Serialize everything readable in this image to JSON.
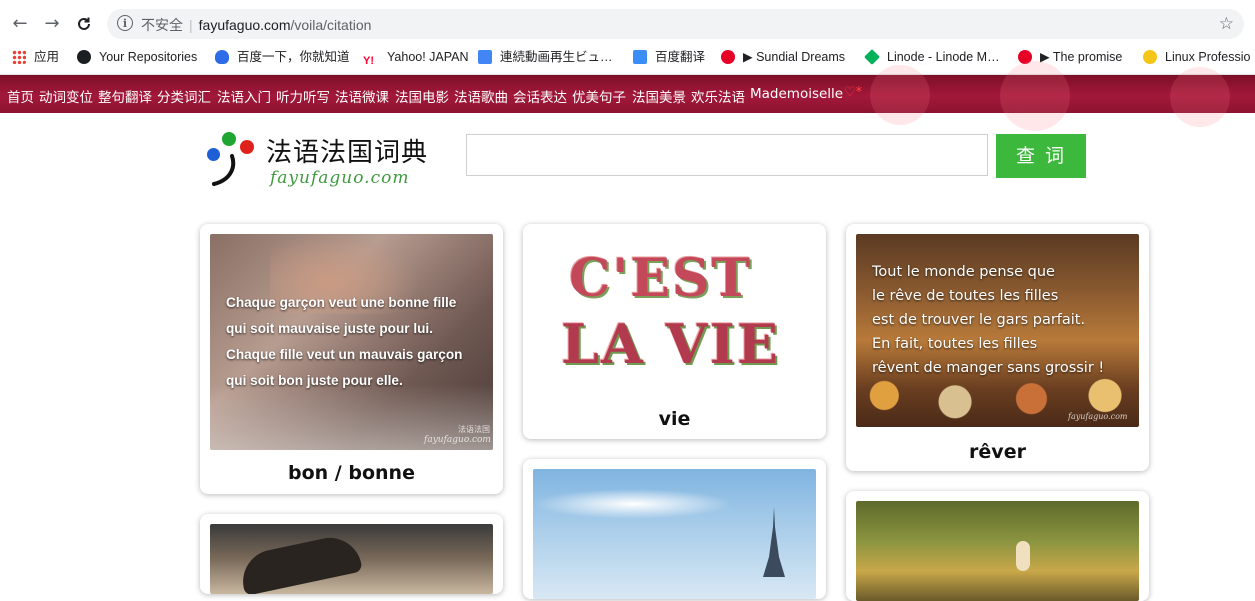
{
  "browser": {
    "back_icon": "arrow-left-icon",
    "forward_icon": "arrow-right-icon",
    "reload_icon": "reload-icon",
    "security_label": "不安全",
    "url_host": "fayufaguo.com",
    "url_path": "/voila/citation",
    "bookmark_star_icon": "star-icon"
  },
  "bookmarks": [
    {
      "label": "应用",
      "icon": "apps-grid-icon"
    },
    {
      "label": "Your Repositories",
      "icon": "github-icon"
    },
    {
      "label": "百度一下，你就知道",
      "icon": "baidu-paw-icon"
    },
    {
      "label": "Yahoo! JAPAN",
      "icon": "yahoo-icon"
    },
    {
      "label": "連続動画再生ビュ…",
      "icon": "doc-icon"
    },
    {
      "label": "百度翻译",
      "icon": "translate-icon"
    },
    {
      "label": "▶ Sundial Dreams",
      "icon": "netease-music-icon"
    },
    {
      "label": "Linode - Linode M…",
      "icon": "linode-icon"
    },
    {
      "label": "▶ The promise",
      "icon": "netease-music-icon"
    },
    {
      "label": "Linux Professio",
      "icon": "linux-icon"
    }
  ],
  "site_nav": [
    "首页",
    "动词变位",
    "整句翻译",
    "分类词汇",
    "法语入门",
    "听力听写",
    "法语微课",
    "法国电影",
    "法语歌曲",
    "会话表达",
    "优美句子",
    "法国美景",
    "欢乐法语",
    "Mademoiselle"
  ],
  "site_nav_heart": "♡*",
  "logo": {
    "title": "法语法国词典",
    "subtitle": "fayufaguo.com"
  },
  "search": {
    "value": "",
    "button_label": "查 词"
  },
  "cards": [
    {
      "word": "bon / bonne",
      "image_icon": "couple-photo",
      "quote": [
        "Chaque garçon veut une bonne fille",
        "qui soit mauvaise juste pour lui.",
        "Chaque fille veut un mauvais garçon",
        "qui soit bon juste pour elle."
      ],
      "watermark_cn": "法语法国",
      "watermark": "fayufaguo.com"
    },
    {
      "word": "vie",
      "image_icon": "floral-lettering",
      "lettering_line1": "C'EST",
      "lettering_line2": "LA VIE"
    },
    {
      "word": "rêver",
      "image_icon": "pastry-shop-photo",
      "quote": [
        "Tout le monde pense que",
        "le rêve de toutes les filles",
        "est de trouver le gars parfait.",
        "En fait, toutes les filles",
        "rêvent de manger sans grossir !"
      ],
      "watermark": "fayufaguo.com"
    },
    {
      "image_icon": "hands-photo"
    },
    {
      "image_icon": "eiffel-tower-photo"
    },
    {
      "image_icon": "forest-path-photo"
    }
  ],
  "colors": {
    "nav_bg": "#8c1330",
    "search_button": "#3cb83c",
    "logo_green": "#3f9a3f"
  }
}
